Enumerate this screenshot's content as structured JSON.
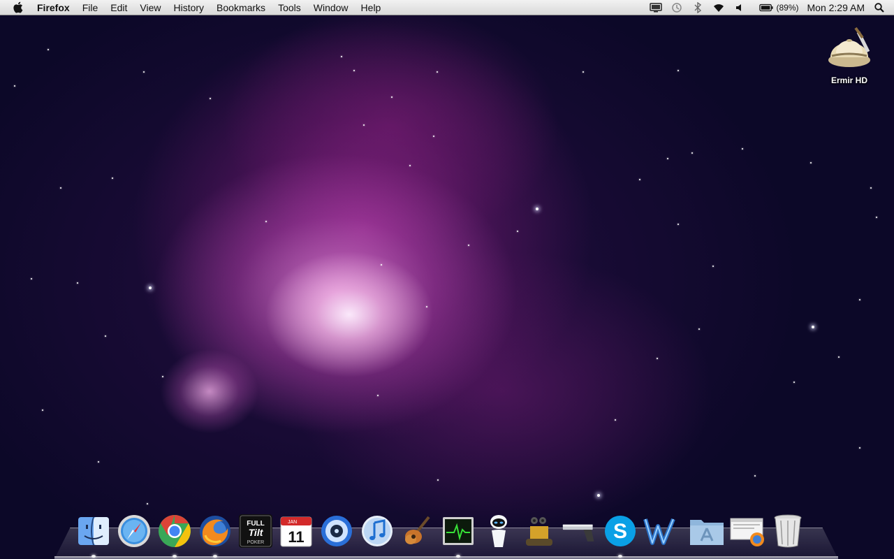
{
  "menubar": {
    "app_name": "Firefox",
    "menus": [
      "File",
      "Edit",
      "View",
      "History",
      "Bookmarks",
      "Tools",
      "Window",
      "Help"
    ],
    "battery_percent": "(89%)",
    "clock": "Mon 2:29 AM",
    "tray_icons": [
      "display-icon",
      "time-machine-icon",
      "bluetooth-icon",
      "wifi-icon",
      "volume-icon",
      "battery-icon"
    ]
  },
  "desktop": {
    "icons": [
      {
        "label": "Ermir HD",
        "icon": "hard-drive-icon"
      }
    ]
  },
  "dock": {
    "items": [
      {
        "name": "finder-icon"
      },
      {
        "name": "safari-icon"
      },
      {
        "name": "chrome-icon"
      },
      {
        "name": "firefox-icon"
      },
      {
        "name": "full-tilt-poker-icon",
        "text": "FULL TILT POKER"
      },
      {
        "name": "ical-icon",
        "month": "JAN",
        "day": "11"
      },
      {
        "name": "dvd-player-icon"
      },
      {
        "name": "itunes-icon"
      },
      {
        "name": "garageband-icon"
      },
      {
        "name": "activity-monitor-icon"
      },
      {
        "name": "eve-robot-icon"
      },
      {
        "name": "wall-e-icon"
      },
      {
        "name": "gun-icon"
      },
      {
        "name": "skype-icon"
      },
      {
        "name": "word-icon"
      },
      {
        "name": "applications-folder-icon"
      },
      {
        "name": "downloads-stack-icon"
      },
      {
        "name": "trash-icon"
      }
    ]
  }
}
